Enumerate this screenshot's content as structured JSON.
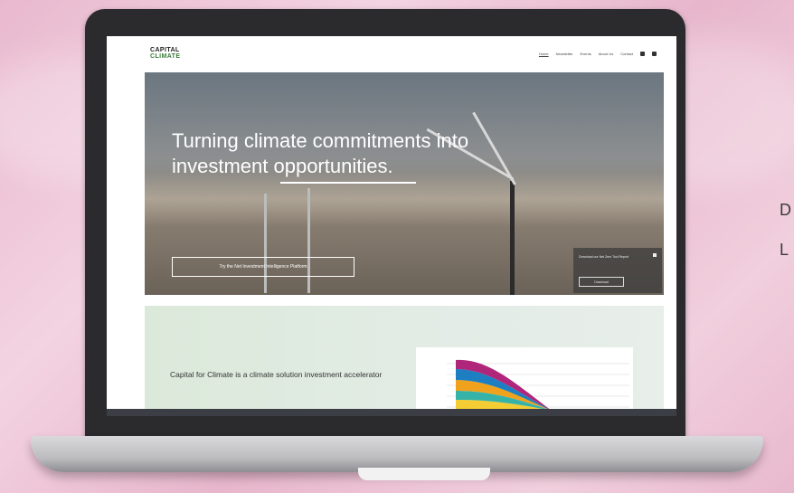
{
  "logo": {
    "line1": "CAPITAL",
    "line2": "CLIMATE"
  },
  "nav": {
    "items": [
      "Home",
      "Newsletter",
      "Events",
      "About Us",
      "Contact"
    ]
  },
  "hero": {
    "headline": "Turning climate commitments into investment opportunities.",
    "cta": "Try the Net Investment Intelligence Platform"
  },
  "popup": {
    "text": "Download our Net Zero Tool Report",
    "button": "Download"
  },
  "section": {
    "text": "Capital for Climate is a climate solution investment accelerator"
  },
  "side": {
    "line1": "D",
    "line2": "L"
  },
  "colors": {
    "chart_purple": "#b0267a",
    "chart_blue": "#1d7fc1",
    "chart_orange": "#f0a21c",
    "chart_teal": "#36b3a9",
    "chart_yellow": "#f4cc34"
  }
}
